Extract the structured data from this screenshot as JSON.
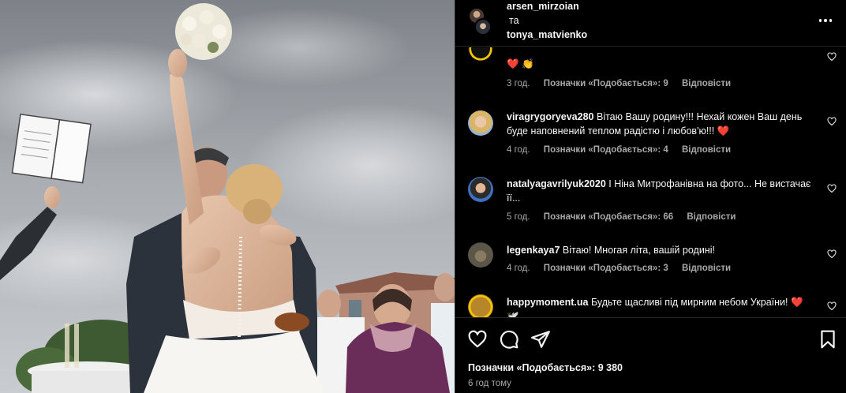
{
  "post": {
    "author": "arsen_mirzoian",
    "connector": "та",
    "coauthor": "tonya_matvienko",
    "likes_text": "Позначки «Подобається»: 9 380",
    "posted_ago": "6 год тому"
  },
  "comments": [
    {
      "username": "",
      "text": "❤️ 👏",
      "time": "3 год.",
      "likes": "Позначки «Подобається»: 9",
      "reply": "Відповісти"
    },
    {
      "username": "viragrygoryeva280",
      "text": "Вітаю Вашу родину!!! Нехай кожен Ваш день буде наповнений теплом радістю і любов'ю!!! ❤️",
      "time": "4 год.",
      "likes": "Позначки «Подобається»: 4",
      "reply": "Відповісти"
    },
    {
      "username": "natalyagavrilyuk2020",
      "text": "І Ніна Митрофанівна на фото... Не вистачає її...",
      "time": "5 год.",
      "likes": "Позначки «Подобається»: 66",
      "reply": "Відповісти"
    },
    {
      "username": "legenkaya7",
      "text": "Вітаю! Многая літа, вашій родині!",
      "time": "4 год.",
      "likes": "Позначки «Подобається»: 3",
      "reply": "Відповісти"
    },
    {
      "username": "happymoment.ua",
      "text": "Будьте щасливі під мирним небом України! ❤️ 🕊️",
      "time": "",
      "likes": "",
      "reply": ""
    }
  ],
  "colors": {
    "background": "#000000",
    "text": "#f5f5f5",
    "muted": "#a8a8a8",
    "divider": "#262626"
  },
  "icons": [
    "more-icon",
    "heart-icon",
    "comment-icon",
    "share-icon",
    "bookmark-icon"
  ]
}
